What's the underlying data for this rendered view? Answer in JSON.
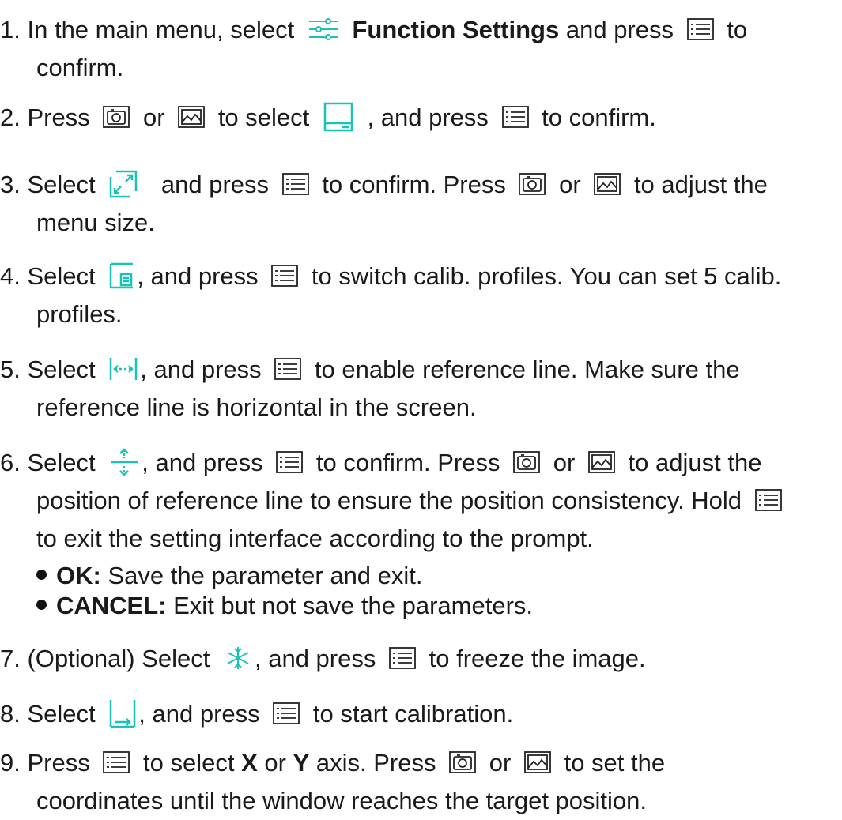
{
  "steps": [
    {
      "n": "1.",
      "parts": [
        "In the main menu, select",
        "Function Settings",
        "and press",
        "to",
        "confirm."
      ]
    },
    {
      "n": "2.",
      "parts": [
        "Press",
        "or",
        "to select",
        ", and press",
        "to confirm."
      ]
    },
    {
      "n": "3.",
      "parts": [
        "Select",
        "and press",
        "to confirm. Press",
        "or",
        "to adjust the",
        "menu size."
      ]
    },
    {
      "n": "4.",
      "parts": [
        "Select",
        ", and press",
        "to switch calib. profiles. You can set 5 calib.",
        "profiles."
      ]
    },
    {
      "n": "5.",
      "parts": [
        "Select",
        ", and press",
        "to enable reference line. Make sure the",
        "reference line is horizontal in the screen."
      ]
    },
    {
      "n": "6.",
      "parts": [
        "Select",
        ", and press",
        "to confirm. Press",
        "or",
        "to adjust the",
        "position of reference line to ensure the position consistency. Hold",
        "to exit the setting interface according to the prompt."
      ]
    },
    {
      "n": "7.",
      "parts": [
        "(Optional) Select",
        ", and press",
        "to freeze the image."
      ]
    },
    {
      "n": "8.",
      "parts": [
        "Select",
        ", and press",
        "to start calibration."
      ]
    },
    {
      "n": "9.",
      "parts": [
        "Press",
        "to select",
        "X",
        "or",
        "Y",
        "axis. Press",
        "or",
        "to set the",
        "coordinates until the window reaches the target position."
      ]
    }
  ],
  "bullets": [
    {
      "label": "OK:",
      "text": "Save the parameter and exit."
    },
    {
      "label": "CANCEL:",
      "text": "Exit but not save the parameters."
    }
  ],
  "icons": {
    "function_settings": "sliders-icon",
    "menu": "menu-button-icon",
    "camera": "camera-button-icon",
    "gallery": "gallery-button-icon",
    "monitor": "display-calibration-icon",
    "zoom": "menu-size-icon",
    "profile": "calib-profile-icon",
    "refline": "reference-line-icon",
    "position": "line-position-icon",
    "freeze": "freeze-icon",
    "calibrate": "start-calibration-icon"
  },
  "colors": {
    "accent": "#19c4b6",
    "text": "#1a1a1a"
  }
}
